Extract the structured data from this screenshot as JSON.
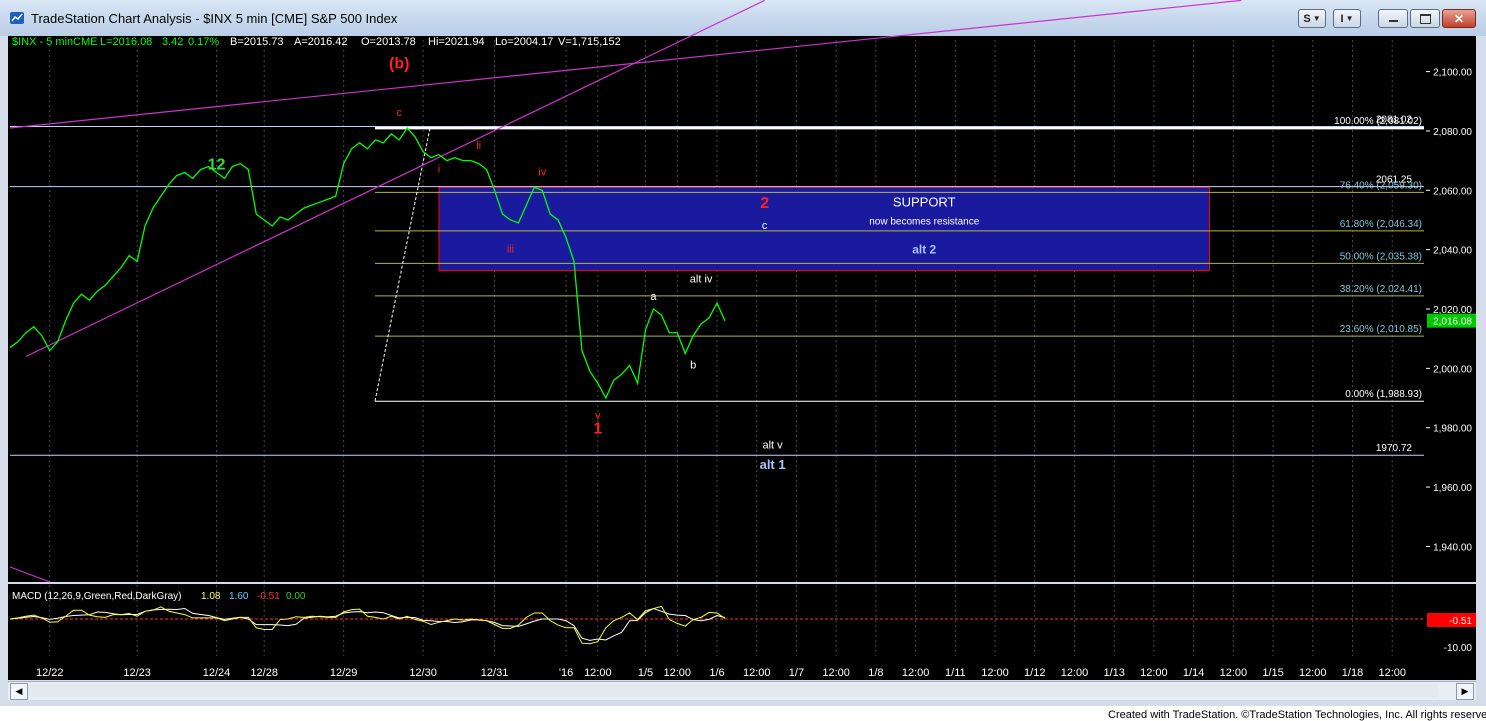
{
  "window": {
    "title": "TradeStation Chart Analysis - $INX 5 min [CME] S&P 500 Index",
    "buttons": {
      "s_label": "S",
      "menu_label": "I"
    }
  },
  "header": {
    "symbol": "$INX - 5 min",
    "exchange": "CME",
    "last": "L=2016.08",
    "change": "3.42",
    "change_pct": "0.17%",
    "bid": "B=2015.73",
    "ask": "A=2016.42",
    "open": "O=2013.78",
    "high": "Hi=2021.94",
    "low": "Lo=2004.17",
    "volume": "V=1,715,152"
  },
  "colors": {
    "price_line": "#00ff00",
    "channel": "#cc33cc",
    "wave_red": "#ff0000",
    "support_box": "#1a1a9e",
    "fib_line": "#b5b54a",
    "header_text": "#00ff00",
    "axis_text": "#ffffff",
    "last_price_tag": "#00c800",
    "macd_tag": "#ff0000"
  },
  "footer": "Created with TradeStation. ©TradeStation Technologies, Inc. All rights reserved.",
  "macd": {
    "label": "MACD (12,26,9,Green,Red,DarkGray)",
    "macd_value": "1.08",
    "signal_value": "1.60",
    "diff_value": "-0.51",
    "zero_value": "0.00",
    "tag": "-0.51",
    "y_ticks": [
      "-10.00"
    ]
  },
  "chart_data": {
    "type": "line",
    "title": "$INX 5 min [CME] S&P 500 Index",
    "ylim": [
      1928,
      2112
    ],
    "y_ticks": [
      1940,
      1960,
      1980,
      2000,
      2020,
      2040,
      2060,
      2080,
      2100
    ],
    "y_tick_labels": [
      "1,940.00",
      "1,960.00",
      "1,980.00",
      "2,000.00",
      "2,020.00",
      "2,040.00",
      "2,060.00",
      "2,080.00",
      "2,100.00"
    ],
    "x_ticks": [
      "12/22",
      "12/23",
      "12/24",
      "12/28",
      "12/29",
      "12/30",
      "12/31",
      "'16",
      "12:00",
      "1/5",
      "12:00",
      "1/6",
      "12:00",
      "1/7",
      "12:00",
      "1/8",
      "12:00",
      "1/11",
      "12:00",
      "1/12",
      "12:00",
      "1/13",
      "12:00",
      "1/14",
      "12:00",
      "1/15",
      "12:00",
      "1/18",
      "12:00"
    ],
    "x_tick_index": [
      5,
      16,
      26,
      32,
      42,
      52,
      61,
      70,
      74,
      80,
      84,
      89,
      94,
      99,
      104,
      109,
      114,
      119,
      124,
      129,
      134,
      139,
      144,
      149,
      154,
      159,
      164,
      169,
      174
    ],
    "x_range": [
      0,
      178
    ],
    "price_series": {
      "name": "$INX",
      "points": [
        [
          0,
          2007
        ],
        [
          1,
          2009
        ],
        [
          2,
          2012
        ],
        [
          3,
          2014
        ],
        [
          4,
          2011
        ],
        [
          5,
          2006
        ],
        [
          6,
          2009
        ],
        [
          7,
          2016
        ],
        [
          8,
          2022
        ],
        [
          9,
          2025
        ],
        [
          10,
          2023
        ],
        [
          11,
          2026
        ],
        [
          12,
          2028
        ],
        [
          13,
          2031
        ],
        [
          14,
          2034
        ],
        [
          15,
          2038
        ],
        [
          16,
          2036
        ],
        [
          17,
          2048
        ],
        [
          18,
          2054
        ],
        [
          19,
          2058
        ],
        [
          20,
          2062
        ],
        [
          21,
          2065
        ],
        [
          22,
          2066
        ],
        [
          23,
          2064
        ],
        [
          24,
          2067
        ],
        [
          25,
          2068
        ],
        [
          26,
          2066
        ],
        [
          27,
          2064
        ],
        [
          28,
          2068
        ],
        [
          29,
          2069
        ],
        [
          30,
          2067
        ],
        [
          31,
          2052
        ],
        [
          32,
          2050
        ],
        [
          33,
          2048
        ],
        [
          34,
          2051
        ],
        [
          35,
          2050
        ],
        [
          36,
          2052
        ],
        [
          37,
          2054
        ],
        [
          38,
          2055
        ],
        [
          39,
          2056
        ],
        [
          40,
          2057
        ],
        [
          41,
          2058
        ],
        [
          42,
          2069
        ],
        [
          43,
          2074
        ],
        [
          44,
          2076
        ],
        [
          45,
          2074
        ],
        [
          46,
          2077
        ],
        [
          47,
          2076
        ],
        [
          48,
          2079
        ],
        [
          49,
          2077
        ],
        [
          50,
          2081
        ],
        [
          51,
          2078
        ],
        [
          52,
          2073
        ],
        [
          53,
          2071
        ],
        [
          54,
          2072
        ],
        [
          55,
          2070
        ],
        [
          56,
          2071
        ],
        [
          57,
          2070
        ],
        [
          58,
          2070
        ],
        [
          59,
          2069
        ],
        [
          60,
          2067
        ],
        [
          61,
          2060
        ],
        [
          62,
          2052
        ],
        [
          63,
          2050
        ],
        [
          64,
          2049
        ],
        [
          65,
          2055
        ],
        [
          66,
          2061
        ],
        [
          67,
          2060
        ],
        [
          68,
          2052
        ],
        [
          69,
          2050
        ],
        [
          70,
          2044
        ],
        [
          71,
          2036
        ],
        [
          72,
          2006
        ],
        [
          73,
          1999
        ],
        [
          74,
          1995
        ],
        [
          75,
          1990
        ],
        [
          76,
          1996
        ],
        [
          77,
          1998
        ],
        [
          78,
          2001
        ],
        [
          79,
          1995
        ],
        [
          80,
          2013
        ],
        [
          81,
          2020
        ],
        [
          82,
          2018
        ],
        [
          83,
          2012
        ],
        [
          84,
          2012
        ],
        [
          85,
          2005
        ],
        [
          86,
          2011
        ],
        [
          87,
          2015
        ],
        [
          88,
          2017
        ],
        [
          89,
          2022
        ],
        [
          90,
          2016
        ]
      ]
    },
    "channel_lines": [
      {
        "from": [
          2,
          2004
        ],
        "to": [
          95,
          2124
        ]
      },
      {
        "from": [
          0,
          2081
        ],
        "to": [
          155,
          2124
        ]
      }
    ],
    "support_zone": {
      "from_x": 54,
      "to_x": 151,
      "y_low": 2033,
      "y_high": 2061,
      "label": "SUPPORT",
      "sublabel": "now becomes resistance",
      "alt_label": "alt 2"
    },
    "fib_levels": [
      {
        "label": "100.00% (2,081.02)",
        "value": 2081.02
      },
      {
        "label": "76.40% (2,059.30)",
        "value": 2059.3
      },
      {
        "label": "61.80% (2,046.34)",
        "value": 2046.34
      },
      {
        "label": "50.00% (2,035.38)",
        "value": 2035.38
      },
      {
        "label": "38.20% (2,024.41)",
        "value": 2024.41
      },
      {
        "label": "23.60% (2,010.85)",
        "value": 2010.85
      },
      {
        "label": "0.00% (1,988.93)",
        "value": 1988.93
      }
    ],
    "horizontal_levels": [
      {
        "label": "2081.02",
        "value": 2081.5
      },
      {
        "label": "2061.25",
        "value": 2061.25
      },
      {
        "label": "1970.72",
        "value": 1970.72
      }
    ],
    "wave_labels": [
      {
        "text": "(b)",
        "x": 49,
        "y": 2101,
        "color": "red",
        "size": "large"
      },
      {
        "text": "c",
        "x": 49,
        "y": 2085,
        "color": "red",
        "size": "small"
      },
      {
        "text": "i",
        "x": 54,
        "y": 2066,
        "color": "red",
        "size": "small"
      },
      {
        "text": "ii",
        "x": 59,
        "y": 2074,
        "color": "red",
        "size": "small"
      },
      {
        "text": "iii",
        "x": 63,
        "y": 2039,
        "color": "red",
        "size": "small"
      },
      {
        "text": "iv",
        "x": 67,
        "y": 2065,
        "color": "red",
        "size": "small"
      },
      {
        "text": "v",
        "x": 74,
        "y": 1983,
        "color": "red",
        "size": "small"
      },
      {
        "text": "1",
        "x": 74,
        "y": 1978,
        "color": "red",
        "size": "large"
      },
      {
        "text": "2",
        "x": 95,
        "y": 2054,
        "color": "red",
        "size": "large"
      },
      {
        "text": "c",
        "x": 95,
        "y": 2047,
        "color": "white",
        "size": "small"
      },
      {
        "text": "12",
        "x": 26,
        "y": 2067,
        "color": "green",
        "size": "large"
      },
      {
        "text": "a",
        "x": 81,
        "y": 2023,
        "color": "white",
        "size": "small"
      },
      {
        "text": "b",
        "x": 86,
        "y": 2000,
        "color": "white",
        "size": "small"
      },
      {
        "text": "alt iv",
        "x": 87,
        "y": 2029,
        "color": "white",
        "size": "small"
      },
      {
        "text": "alt v",
        "x": 96,
        "y": 1973,
        "color": "white",
        "size": "small"
      },
      {
        "text": "alt 1",
        "x": 96,
        "y": 1966,
        "color": "lightblue",
        "size": "medium"
      }
    ],
    "last_price_tag": "2,016.08"
  }
}
